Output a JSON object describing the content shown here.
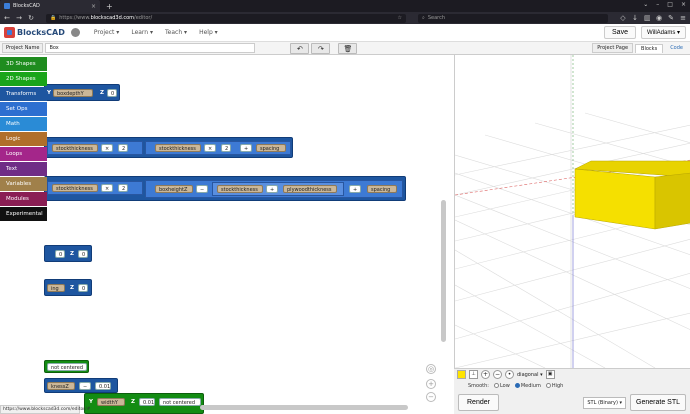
{
  "browser": {
    "tab_title": "BlocksCAD",
    "url_prefix": "https://www.",
    "url_domain": "blockscad3d.com",
    "url_path": "/editor/",
    "search_placeholder": "Search",
    "status_url": "https://www.blockscad3d.com/editor/#"
  },
  "header": {
    "logo_text": "BlocksCAD",
    "menu": [
      "Project ▾",
      "Learn ▾",
      "Teach ▾",
      "Help ▾"
    ],
    "save_label": "Save",
    "user_label": "WillAdams ▾"
  },
  "projectbar": {
    "name_label": "Project Name",
    "name_value": "Box",
    "project_page_label": "Project Page",
    "blocks_tab": "Blocks",
    "code_tab": "Code"
  },
  "toolbox": [
    {
      "label": "3D Shapes",
      "color": "#1e8c1e"
    },
    {
      "label": "2D Shapes",
      "color": "#1aa51a"
    },
    {
      "label": "Transforms",
      "color": "#1e56a0"
    },
    {
      "label": "Set Ops",
      "color": "#2d6fd0"
    },
    {
      "label": "Math",
      "color": "#2a8bd6"
    },
    {
      "label": "Logic",
      "color": "#b06f2b"
    },
    {
      "label": "Loops",
      "color": "#a4268a"
    },
    {
      "label": "Text",
      "color": "#6f2d86"
    },
    {
      "label": "Variables",
      "color": "#a0804a"
    },
    {
      "label": "Modules",
      "color": "#8a1e54"
    },
    {
      "label": "Experimental",
      "color": "#111111"
    }
  ],
  "blocks": {
    "b1": {
      "var": "boxdepthY",
      "axis": "Z",
      "value": "0"
    },
    "b2": {
      "var1": "stockthickness",
      "op1": "×",
      "num1": "2",
      "var2": "stockthickness",
      "op2": "×",
      "num2": "2",
      "op3": "+",
      "var3": "spacing"
    },
    "b3": {
      "var1": "stockthickness",
      "op1": "×",
      "num1": "2",
      "var2": "boxheightZ",
      "op2": "−",
      "var3": "stockthickness",
      "op3": "+",
      "var4": "plywoodthickness",
      "op4": "+",
      "var5": "spacing"
    },
    "b4": {
      "value1": "0",
      "axis": "Z",
      "value2": "0"
    },
    "b5": {
      "var": "ing",
      "axis": "Z",
      "value": "0"
    },
    "b6": {
      "option": "not centered"
    },
    "b7": {
      "var": "knessZ",
      "op": "−",
      "value": "0.01"
    },
    "b8": {
      "axis_y": "Y",
      "var": "widthY",
      "axis_z": "Z",
      "value": "0.01",
      "option": "not centered"
    }
  },
  "viewer": {
    "view_option": "diagonal ▾",
    "smooth_label": "Smooth:",
    "smooth_options": [
      "Low",
      "Medium",
      "High"
    ],
    "smooth_selected": "Medium",
    "render_label": "Render",
    "format_option": "STL (Binary) ▾",
    "generate_label": "Generate STL",
    "object_color": "#ffe400"
  }
}
